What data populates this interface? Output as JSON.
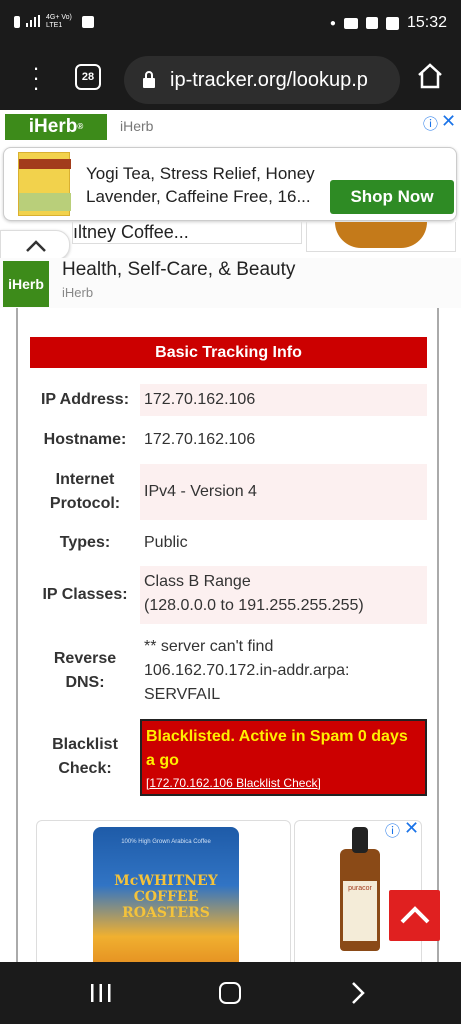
{
  "status_bar": {
    "network_label": "4G+ Vo) LTE1",
    "time": "15:32"
  },
  "browser": {
    "tab_count": "28",
    "url": "ip-tracker.org/lookup.p"
  },
  "ad_top": {
    "brand_logo": "iHerb",
    "brand_name": "iHerb",
    "product_title": "Yogi Tea, Stress Relief, Honey Lavender, Caffeine Free, 16...",
    "shop_button": "Shop Now",
    "partial_card_title": "ıltney Coffee...",
    "banner_logo": "iHerb",
    "banner_title": "Health, Self-Care, & Beauty",
    "banner_subtitle": "iHerb"
  },
  "tracking": {
    "title": "Basic Tracking Info",
    "rows": [
      {
        "label": "IP Address:",
        "value": "172.70.162.106"
      },
      {
        "label": "Hostname:",
        "value": "172.70.162.106"
      },
      {
        "label": "Internet Protocol:",
        "value": "IPv4 - Version 4"
      },
      {
        "label": "Types:",
        "value": "Public"
      },
      {
        "label": "IP Classes:",
        "value": "Class B Range",
        "value2": "(128.0.0.0 to 191.255.255.255)"
      },
      {
        "label": "Reverse DNS:",
        "value": "** server can't find",
        "value2": "106.162.70.172.in-addr.arpa:",
        "value3": "SERVFAIL"
      },
      {
        "label": "Blacklist Check:",
        "value": "Blacklisted. Active in Spam 0 days a go",
        "link": "172.70.162.106 Blacklist Check"
      }
    ]
  },
  "ad_bottom": {
    "coffee_brand": "McWHITNEY COFFEE ROASTERS",
    "coffee_tagline": "100% High Grown Arabica Coffee",
    "oil_brand": "puracor"
  },
  "colors": {
    "accent_red": "#cc0000",
    "iherb_green": "#3d8b1a",
    "blacklist_text": "#ffee00"
  }
}
